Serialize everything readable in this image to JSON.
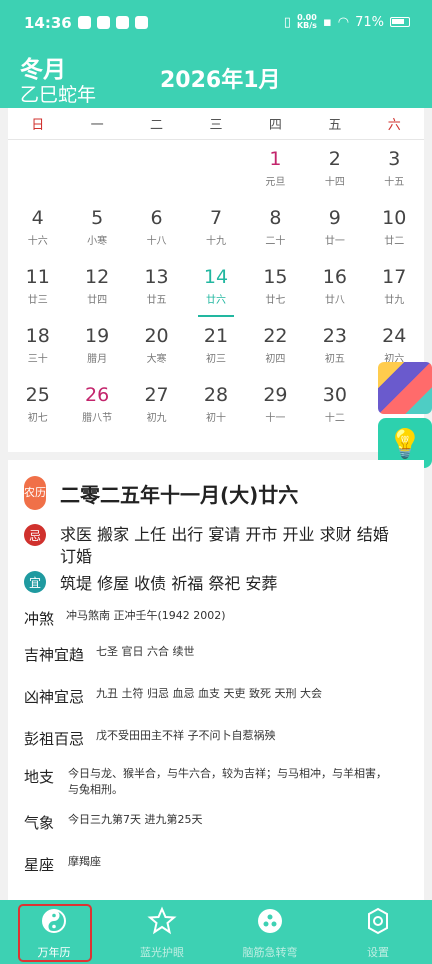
{
  "status_bar": {
    "time": "14:36",
    "speed_top": "0.00",
    "speed_bottom": "KB/s",
    "battery": "71%"
  },
  "header": {
    "lunar_month": "冬月",
    "ganzhi_year": "乙巳蛇年",
    "title": "2026年1月"
  },
  "weekdays": [
    "日",
    "一",
    "二",
    "三",
    "四",
    "五",
    "六"
  ],
  "days": [
    {
      "d": "",
      "l": ""
    },
    {
      "d": "",
      "l": ""
    },
    {
      "d": "",
      "l": ""
    },
    {
      "d": "",
      "l": ""
    },
    {
      "d": "1",
      "l": "元旦"
    },
    {
      "d": "2",
      "l": "十四"
    },
    {
      "d": "3",
      "l": "十五"
    },
    {
      "d": "4",
      "l": "十六"
    },
    {
      "d": "5",
      "l": "小寒"
    },
    {
      "d": "6",
      "l": "十八"
    },
    {
      "d": "7",
      "l": "十九"
    },
    {
      "d": "8",
      "l": "二十"
    },
    {
      "d": "9",
      "l": "廿一"
    },
    {
      "d": "10",
      "l": "廿二"
    },
    {
      "d": "11",
      "l": "廿三"
    },
    {
      "d": "12",
      "l": "廿四"
    },
    {
      "d": "13",
      "l": "廿五"
    },
    {
      "d": "14",
      "l": "廿六"
    },
    {
      "d": "15",
      "l": "廿七"
    },
    {
      "d": "16",
      "l": "廿八"
    },
    {
      "d": "17",
      "l": "廿九"
    },
    {
      "d": "18",
      "l": "三十"
    },
    {
      "d": "19",
      "l": "腊月"
    },
    {
      "d": "20",
      "l": "大寒"
    },
    {
      "d": "21",
      "l": "初三"
    },
    {
      "d": "22",
      "l": "初四"
    },
    {
      "d": "23",
      "l": "初五"
    },
    {
      "d": "24",
      "l": "初六"
    },
    {
      "d": "25",
      "l": "初七"
    },
    {
      "d": "26",
      "l": "腊八节"
    },
    {
      "d": "27",
      "l": "初九"
    },
    {
      "d": "28",
      "l": "初十"
    },
    {
      "d": "29",
      "l": "十一"
    },
    {
      "d": "30",
      "l": "十二"
    },
    {
      "d": "",
      "l": ""
    }
  ],
  "detail": {
    "lunar_badge": "农历",
    "lunar_date": "二零二五年十一月(大)廿六",
    "ji_badge": "忌",
    "ji_items": "求医 搬家 上任 出行 宴请 开市 开业 求财 结婚 订婚",
    "yi_badge": "宜",
    "yi_items": "筑堤 修屋 收债 祈福 祭祀 安葬",
    "chongsha_label": "冲煞",
    "chongsha_value": "冲马煞南 正冲壬午(1942 2002)",
    "jishen_label": "吉神宜趋",
    "jishen_value": "七圣 官日 六合 续世",
    "xiongshen_label": "凶神宜忌",
    "xiongshen_value": "九丑 土符 归忌 血忌 血支 天吏 致死 天刑 大会",
    "pengzu_label": "彭祖百忌",
    "pengzu_value": "戊不受田田主不祥 子不问卜自惹祸殃",
    "dizhi_label": "地支",
    "dizhi_value": "今日与龙、猴半合，与牛六合，较为吉祥；与马相冲，与羊相害，与兔相刑。",
    "qixiang_label": "气象",
    "qixiang_value": "今日三九第7天 进九第25天",
    "xingzuo_label": "星座",
    "xingzuo_value": "摩羯座"
  },
  "nav": [
    {
      "label": "万年历",
      "icon": "yin-yang-icon"
    },
    {
      "label": "蓝光护眼",
      "icon": "star-icon"
    },
    {
      "label": "脑筋急转弯",
      "icon": "share-nodes-icon"
    },
    {
      "label": "设置",
      "icon": "gear-icon"
    }
  ]
}
